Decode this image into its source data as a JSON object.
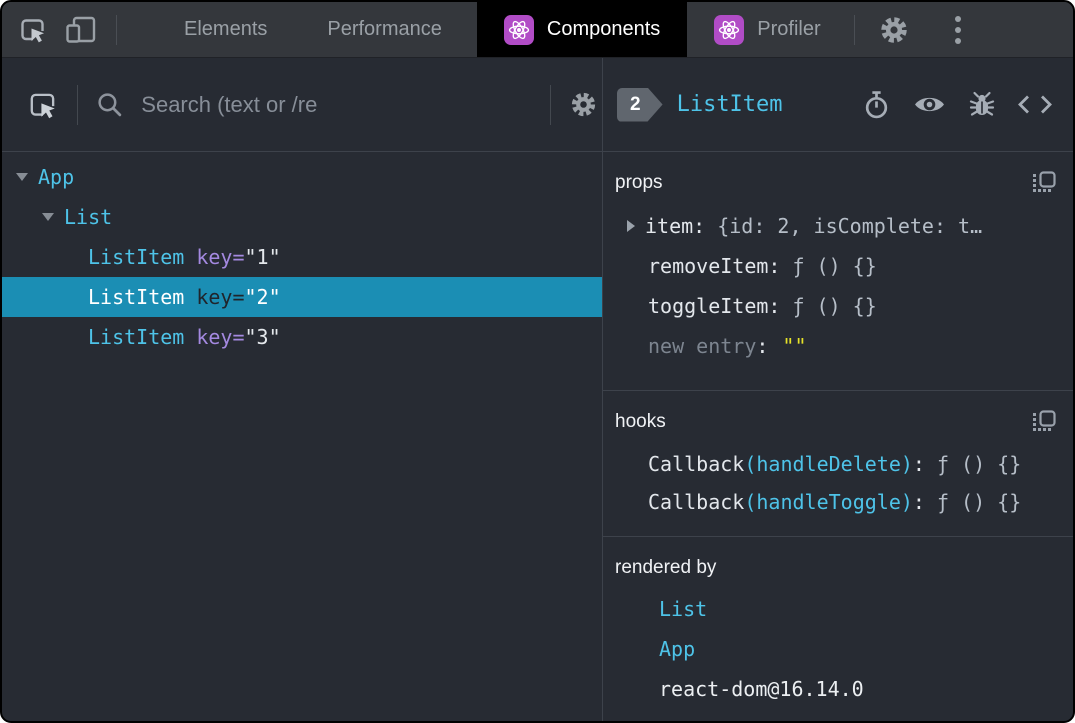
{
  "topbar": {
    "tabs": [
      {
        "label": "Elements"
      },
      {
        "label": "Performance"
      },
      {
        "label": "Components"
      },
      {
        "label": "Profiler"
      }
    ]
  },
  "left_panel": {
    "search": {
      "placeholder": "Search (text or /re"
    },
    "tree": [
      {
        "name": "App"
      },
      {
        "name": "List"
      },
      {
        "name": "ListItem",
        "key_label": "key",
        "eq": "=",
        "key_value": "\"1\""
      },
      {
        "name": "ListItem",
        "key_label": "key",
        "eq": "=",
        "key_value": "\"2\""
      },
      {
        "name": "ListItem",
        "key_label": "key",
        "eq": "=",
        "key_value": "\"3\""
      }
    ]
  },
  "right_panel": {
    "header": {
      "badge": "2",
      "component": "ListItem"
    },
    "props": {
      "title": "props",
      "item": {
        "name": "item",
        "colon": ":",
        "value": "{id: 2, isComplete: t…"
      },
      "remove": {
        "name": "removeItem",
        "colon": ":",
        "value": "ƒ () {}"
      },
      "toggle": {
        "name": "toggleItem",
        "colon": ":",
        "value": "ƒ () {}"
      },
      "new_entry": {
        "name": "new entry",
        "colon": ":",
        "value": "\"\""
      }
    },
    "hooks": {
      "title": "hooks",
      "rows": [
        {
          "base": "Callback",
          "fn": "(handleDelete)",
          "colon": ":",
          "value": "ƒ () {}"
        },
        {
          "base": "Callback",
          "fn": "(handleToggle)",
          "colon": ":",
          "value": "ƒ () {}"
        }
      ]
    },
    "rendered_by": {
      "title": "rendered by",
      "owners": [
        {
          "label": "List"
        },
        {
          "label": "App"
        },
        {
          "label": "react-dom@16.14.0"
        }
      ]
    }
  },
  "colors": {
    "accent_cyan": "#4ec3e8",
    "selection_blue": "#1b8eb4",
    "key_purple": "#a489e0",
    "string_yellow": "#e6e229",
    "react_purple": "#b14cc6",
    "panel_bg": "#272b33",
    "topbar_bg": "#34373c"
  }
}
